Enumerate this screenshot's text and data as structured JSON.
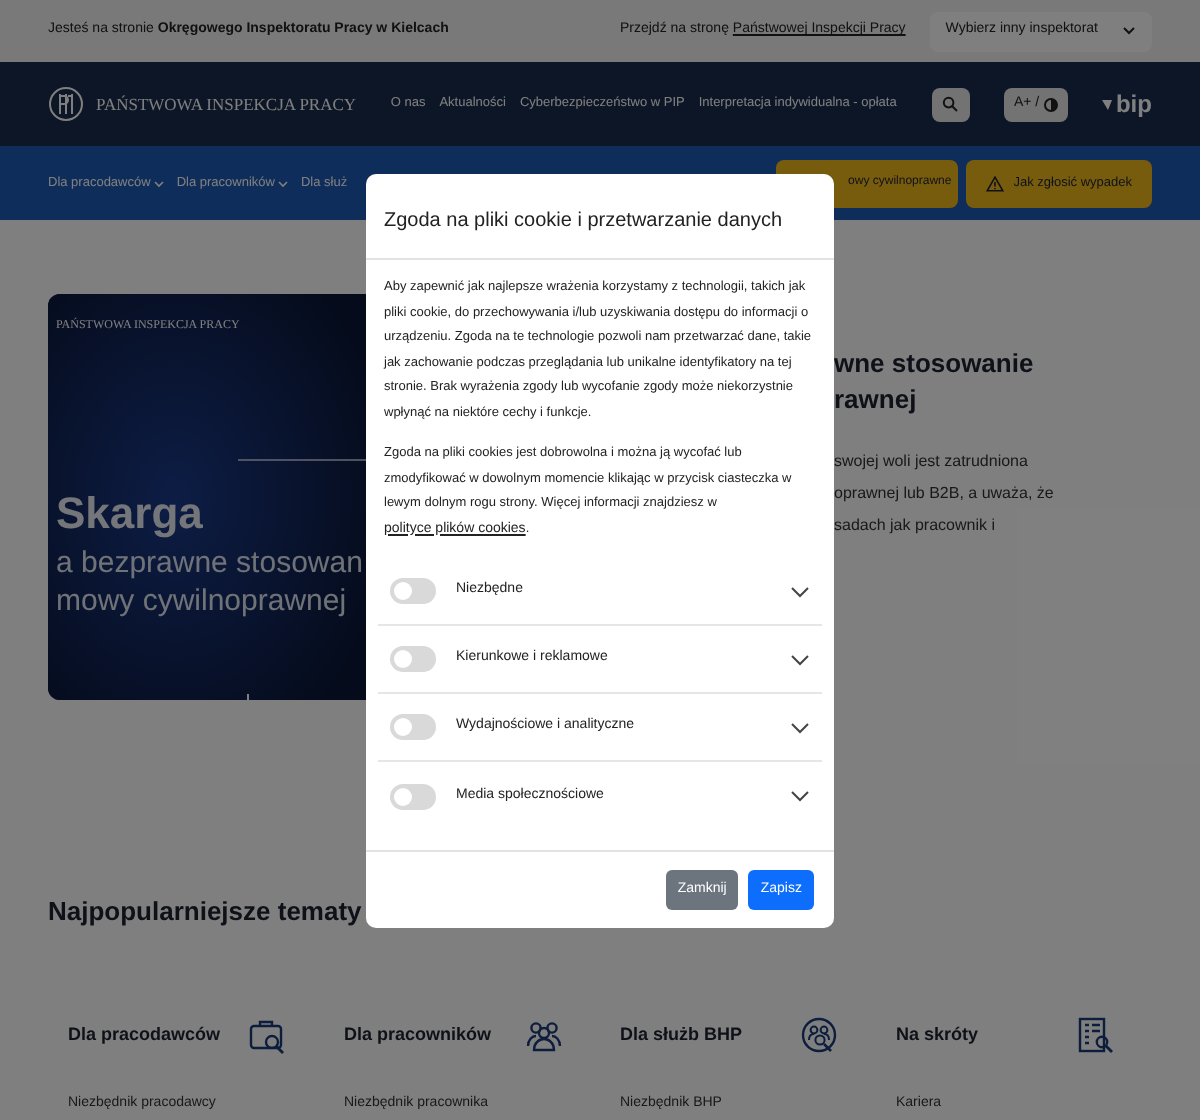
{
  "top_bar": {
    "location_text": "Jesteś na stronie **Okręgowego Inspektoratu Pracy w Kielcach**",
    "go_to_text": "Przejdź na stronę",
    "go_to_link": "Państwowej Inspekcji Pracy",
    "inspectorate_select": "Wybierz inny inspektorat"
  },
  "header": {
    "logo_text": "PAŃSTWOWA INSPEKCJA PRACY",
    "nav": [
      "O nas",
      "Aktualności",
      "Cyberbezpieczeństwo w PIP",
      "Interpretacja indywidualna - opłata"
    ],
    "font_size_label": "A+ /",
    "bip_label": "bip"
  },
  "menu_bar": {
    "items": [
      {
        "label": "Dla pracodawców",
        "dropdown": true
      },
      {
        "label": "Dla pracowników",
        "dropdown": true
      },
      {
        "label": "Dla służ",
        "dropdown": false
      }
    ],
    "buttons": [
      {
        "kind": "plain",
        "label": "owy cywilnoprawne"
      },
      {
        "kind": "warning",
        "label": "Jak zgłosić wypadek"
      }
    ]
  },
  "hero": {
    "banner_brand": "PAŃSTWOWA INSPEKCJA PRACY",
    "banner_title": "Skarga",
    "banner_subtitle": [
      "a bezprawne stosowan",
      "mowy cywilnoprawnej"
    ],
    "heading": [
      "wne stosowanie",
      "rawnej"
    ],
    "text": [
      "swojej woli jest zatrudniona",
      "oprawnej lub B2B, a uważa, że",
      "sadach jak pracownik i"
    ]
  },
  "popular": {
    "title": "Najpopularniejsze tematy",
    "categories": [
      {
        "title": "Dla pracodawców",
        "kind": "briefcase",
        "link": "Niezbędnik pracodawcy"
      },
      {
        "title": "Dla pracowników",
        "kind": "group",
        "link": "Niezbędnik pracownika"
      },
      {
        "title": "Dla służb BHP",
        "kind": "circle",
        "link": "Niezbędnik BHP"
      },
      {
        "title": "Na skróty",
        "kind": "list",
        "link": "Kariera"
      }
    ]
  },
  "cookie_dialog": {
    "title": "Zgoda na pliki cookie i przetwarzanie danych",
    "paragraph_1": "Aby zapewnić jak najlepsze wrażenia korzystamy z technologii, takich jak pliki cookie, do przechowywania i/lub uzyskiwania dostępu do informacji o urządzeniu. Zgoda na te technologie pozwoli nam przetwarzać dane, takie jak zachowanie podczas przeglądania lub unikalne identyfikatory na tej stronie. Brak wyrażenia zgody lub wycofanie zgody może niekorzystnie wpłynąć na niektóre cechy i funkcje.",
    "paragraph_2": "Zgoda na pliki cookies jest dobrowolna i można ją wycofać lub zmodyfikować w dowolnym momencie klikając w przycisk ciasteczka w lewym dolnym rogu strony. Więcej informacji znajdziesz w",
    "policy_link": "polityce plików cookies",
    "paragraph_2_end": ".",
    "categories": [
      {
        "label": "Niezbędne",
        "on": false
      },
      {
        "label": "Kierunkowe i reklamowe",
        "on": false
      },
      {
        "label": "Wydajnościowe i analityczne",
        "on": false
      },
      {
        "label": "Media społecznościowe",
        "on": false
      }
    ],
    "buttons": [
      {
        "kind": "secondary",
        "label": "Zamknij"
      },
      {
        "kind": "primary",
        "label": "Zapisz"
      }
    ]
  }
}
